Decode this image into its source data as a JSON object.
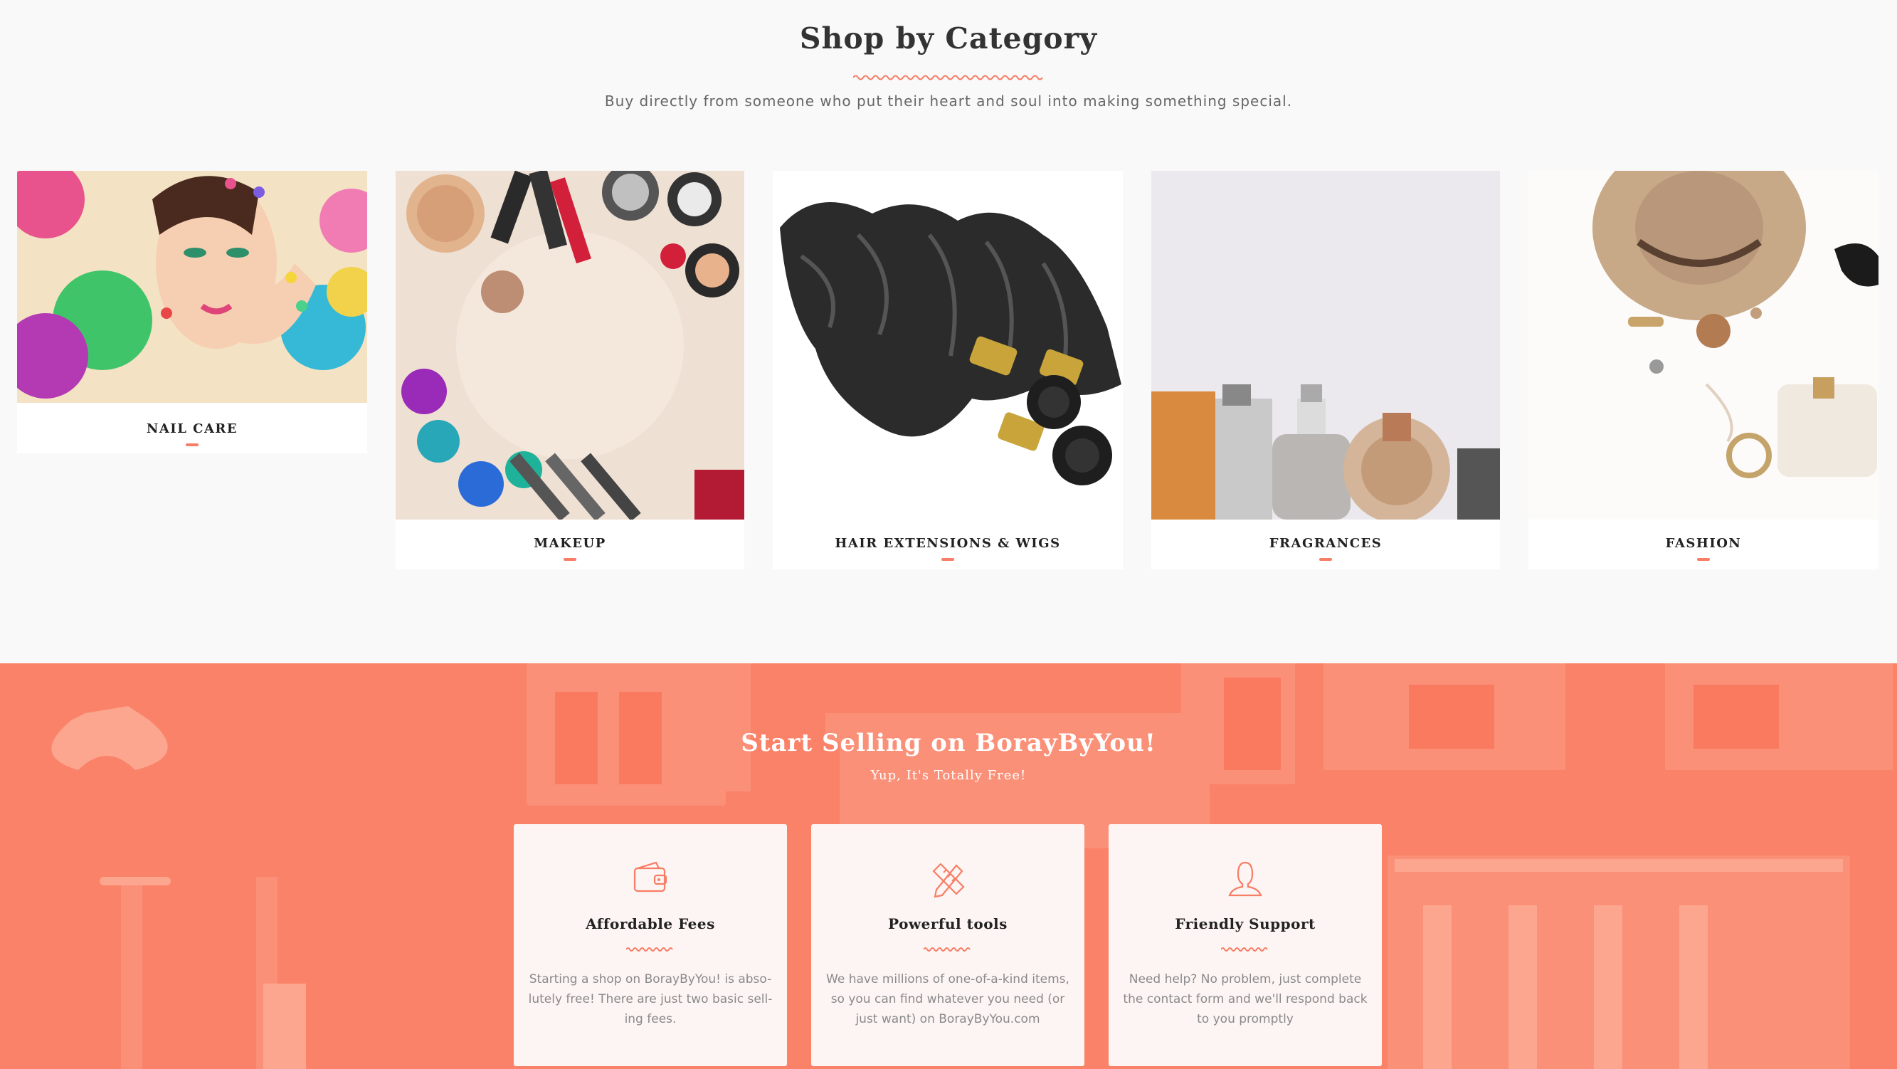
{
  "category_section": {
    "title": "Shop by Category",
    "subtitle": "Buy directly from someone who put their heart and soul into making something special.",
    "categories": [
      {
        "label": "NAIL CARE",
        "image": "nail-care-photo"
      },
      {
        "label": "MAKEUP",
        "image": "makeup-photo"
      },
      {
        "label": "HAIR EXTENSIONS & WIGS",
        "image": "hair-extensions-photo"
      },
      {
        "label": "FRAGRANCES",
        "image": "fragrances-photo"
      },
      {
        "label": "FASHION",
        "image": "fashion-photo"
      }
    ]
  },
  "sell_section": {
    "title": "Start Selling on BorayByYou!",
    "subtitle": "Yup, It's Totally Free!",
    "features": [
      {
        "icon": "wallet-icon",
        "title": "Affordable Fees",
        "text": "Starting a shop on BorayByYou! is abso-lutely free!  There are just two basic sell-ing fees."
      },
      {
        "icon": "pencil-ruler-icon",
        "title": "Powerful tools",
        "text": "We have millions of one-of-a-kind items, so you can find whatever you need (or just want)  on BorayByYou.com"
      },
      {
        "icon": "support-person-icon",
        "title": "Friendly Support",
        "text": "Need help?  No problem,  just complete the contact form  and we'll respond back to you promptly"
      }
    ]
  },
  "colors": {
    "accent": "#f77d66",
    "sell_background": "#fa8268",
    "page_background": "#f9f9f9"
  }
}
